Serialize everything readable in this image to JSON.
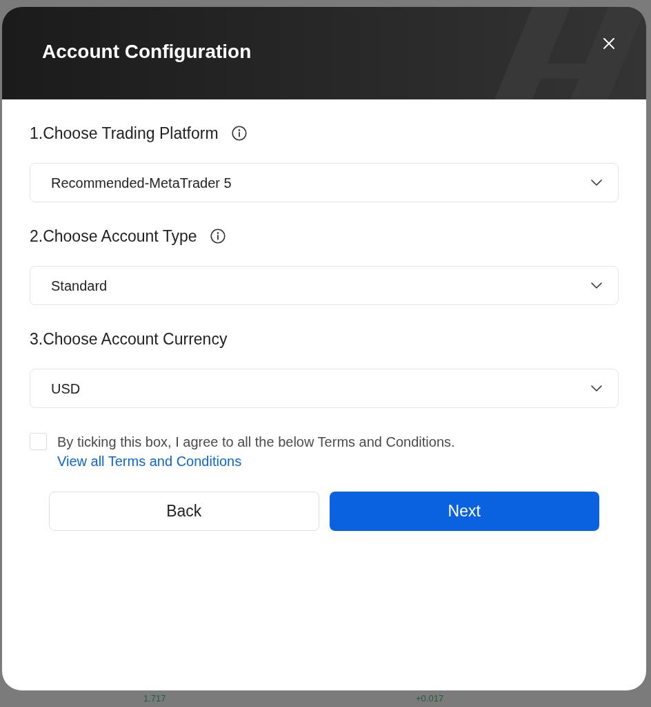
{
  "dialog": {
    "title": "Account Configuration"
  },
  "steps": [
    {
      "label": "1.Choose Trading Platform",
      "info": true,
      "value": "Recommended-MetaTrader 5"
    },
    {
      "label": "2.Choose Account Type",
      "info": true,
      "value": "Standard"
    },
    {
      "label": "3.Choose Account Currency",
      "info": false,
      "value": "USD"
    }
  ],
  "agreement": {
    "checked": false,
    "text": "By ticking this box, I agree to all the below Terms and Conditions.",
    "link": "View all Terms and Conditions"
  },
  "buttons": [
    {
      "label": "Back",
      "kind": "secondary"
    },
    {
      "label": "Next",
      "kind": "primary"
    }
  ],
  "background": {
    "texts": [
      "1.717",
      "+0.017"
    ]
  }
}
